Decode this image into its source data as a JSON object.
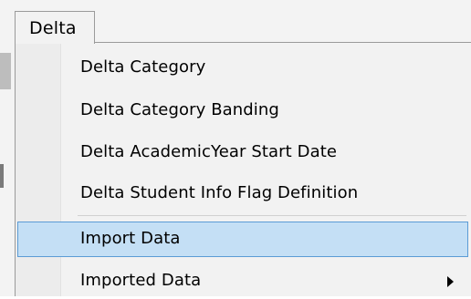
{
  "menu": {
    "title": "Delta",
    "items": [
      {
        "label": "Delta Category"
      },
      {
        "label": "Delta Category Banding"
      },
      {
        "label": "Delta AcademicYear Start Date"
      },
      {
        "label": "Delta Student Info Flag Definition"
      },
      {
        "label": "Import Data",
        "highlighted": true
      },
      {
        "label": "Imported Data",
        "has_submenu": true
      }
    ]
  },
  "colors": {
    "menu_background": "#f2f2f2",
    "highlight_fill": "#c4dff5",
    "highlight_border": "#5b9bd5"
  },
  "icons": {
    "submenu": "chevron-right-icon"
  }
}
